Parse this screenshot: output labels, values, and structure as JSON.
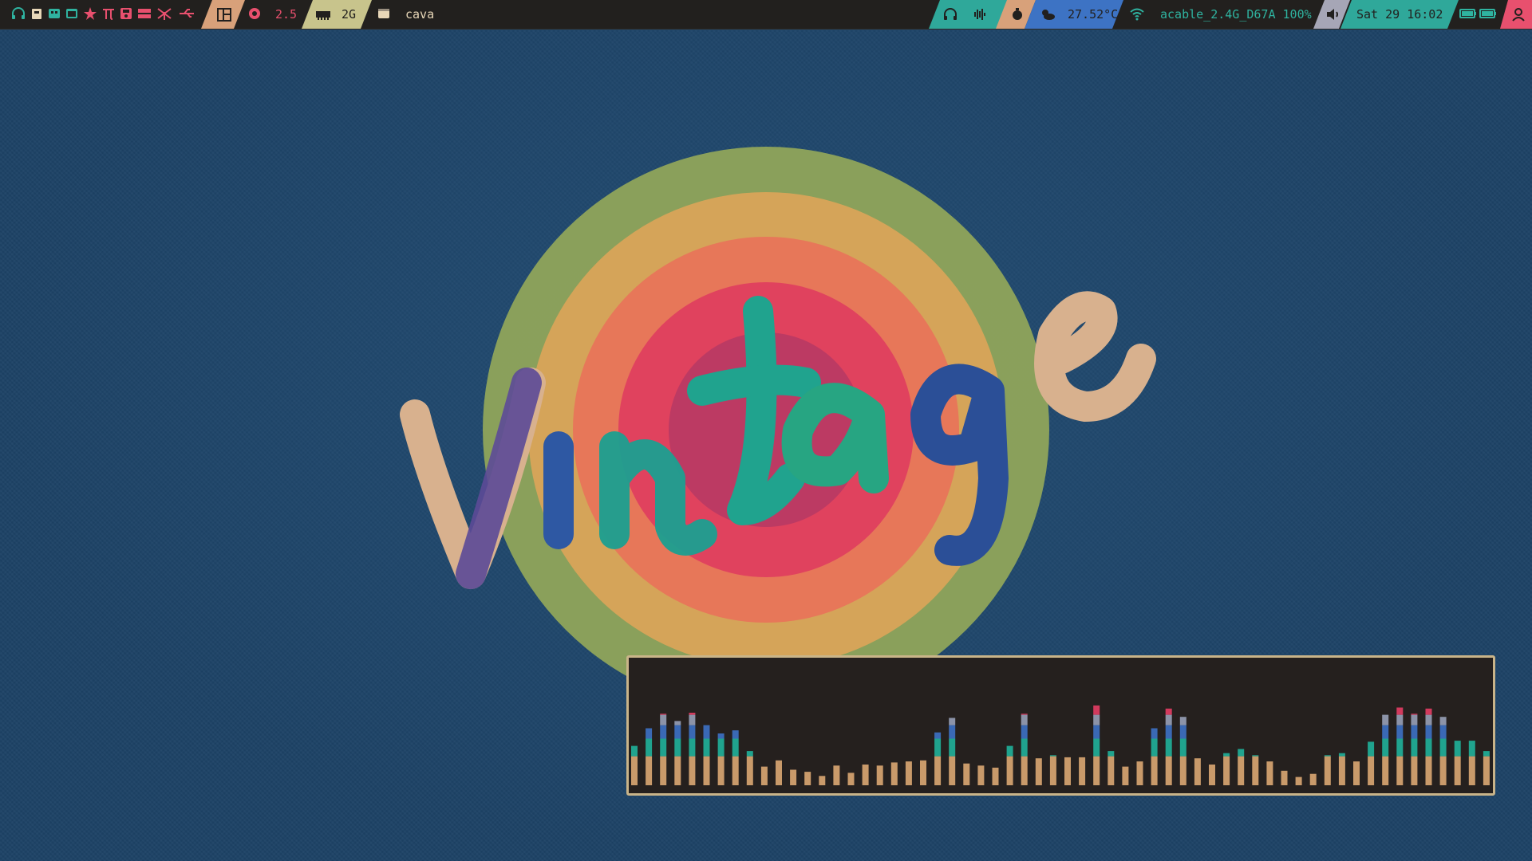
{
  "topbar": {
    "left_icons": [
      "headphones-icon",
      "trash-icon",
      "monitor-icon",
      "window-icon",
      "star-icon",
      "pi-icon",
      "save-icon",
      "storage-icon",
      "network-icon",
      "usb-icon"
    ],
    "layout_icon": "layout-icon",
    "cpu_icon": "cpu-icon",
    "cpu_value": "2.5",
    "mem_icon": "memory-icon",
    "mem_value": "2G",
    "window_icon": "terminal-icon",
    "window_title": "cava",
    "temp_value": "27.52°C",
    "wifi_value": "acable_2.4G_D67A 100%",
    "datetime": "Sat 29 16:02",
    "right_icons": [
      "headphones-icon",
      "audio-wave-icon",
      "timer-icon",
      "weather-icon",
      "wifi-icon",
      "volume-icon",
      "battery-icon",
      "battery-icon",
      "user-icon"
    ]
  },
  "wallpaper": {
    "text": "Vintage",
    "ring_colors": [
      "#8da35b",
      "#d8a45a",
      "#e7755a",
      "#e0405f",
      "#8a3a6e"
    ]
  },
  "cava": {
    "title": "cava",
    "colors": [
      "#c99a6a",
      "#9ea66a",
      "#20a38e",
      "#3a69b5",
      "#8c93a8",
      "#d23a5d"
    ],
    "levels": [
      0.38,
      0.55,
      0.69,
      0.62,
      0.7,
      0.58,
      0.5,
      0.53,
      0.33,
      0.18,
      0.24,
      0.15,
      0.13,
      0.09,
      0.19,
      0.12,
      0.2,
      0.19,
      0.22,
      0.23,
      0.24,
      0.51,
      0.65,
      0.21,
      0.19,
      0.17,
      0.38,
      0.69,
      0.26,
      0.29,
      0.27,
      0.27,
      0.77,
      0.33,
      0.18,
      0.23,
      0.55,
      0.74,
      0.66,
      0.26,
      0.2,
      0.31,
      0.35,
      0.29,
      0.23,
      0.14,
      0.08,
      0.11,
      0.29,
      0.31,
      0.23,
      0.42,
      0.68,
      0.75,
      0.69,
      0.74,
      0.66,
      0.43,
      0.43,
      0.33
    ]
  }
}
